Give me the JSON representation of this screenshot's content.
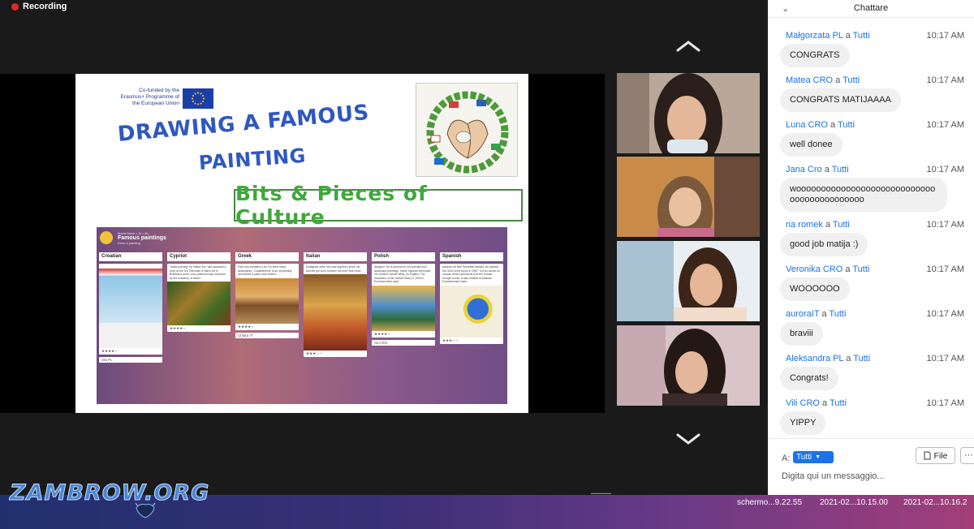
{
  "recording": {
    "label": "Recording",
    "color": "#e02828"
  },
  "slide": {
    "eu_text": "Co-funded by the Erasmus+ Programme of the European Union",
    "title_line1": "DRAWING A FAMOUS",
    "title_line2": "PAINTING",
    "banner": "Bits & Pieces of Culture",
    "padlet": {
      "author": "Marta Batric • 1k • 4h",
      "title": "Famous paintings",
      "subtitle": "Draw a painting",
      "columns": [
        {
          "name": "Croatian",
          "card_text": "",
          "stars": "★★★★☆",
          "footer": "Ola PL"
        },
        {
          "name": "Cypriot",
          "card_text": "Vlatka painting, by Vlatka Vuc, was awarded a prize at the 3rd Triennale of Naive Art in Bratislava and is now posthumously honoured by the academy of others.",
          "stars": "★★★★☆",
          "footer": ""
        },
        {
          "name": "Greek",
          "card_text": "Paris and travelled a lot. He drew many landscapes. 'Coalanthemis' is an oil painting and shows a place near Athens.",
          "stars": "★★★★☆",
          "footer": "Chiara IT"
        },
        {
          "name": "Italian",
          "card_text": "Modigliani when she was eighteen years old and the girl soon became his lover and muse.",
          "stars": "★★★☆☆",
          "footer": ""
        },
        {
          "name": "Polish",
          "card_text": "designer. He is famous for his portraits and landscape paintings. Inside impasto technique. He created 'Zakole Wisly' (in English: The meanders of the Vistula River) in 1904 in Expressionism style.",
          "stars": "★★★★☆",
          "footer": "ria CRO"
        },
        {
          "name": "Spanish",
          "card_text": "abstract art with Surrealist fantasy. He painted the Gold of the Azure in 1967. It is an acrylic on canvas which represents how the human thought works. It was created in Abstract Expressionism style.",
          "stars": "★★★☆☆",
          "footer": ""
        }
      ]
    }
  },
  "chat": {
    "collapse_icon": "chevron-down-icon",
    "title": "Chattare",
    "messages": [
      {
        "sender": "Małgorzata PL",
        "to": "a",
        "recipient": "Tutti",
        "time": "10:17 AM",
        "text": "CONGRATS"
      },
      {
        "sender": "Matea CRO",
        "to": "a",
        "recipient": "Tutti",
        "time": "10:17 AM",
        "text": "CONGRATS MATIJAAAA"
      },
      {
        "sender": "Luna CRO",
        "to": "a",
        "recipient": "Tutti",
        "time": "10:17 AM",
        "text": "well donee"
      },
      {
        "sender": "Jana Cro",
        "to": "a",
        "recipient": "Tutti",
        "time": "10:17 AM",
        "text": "wooooooooooooooooooooooooooooooooooooooooooo"
      },
      {
        "sender": "ria romek",
        "to": "a",
        "recipient": "Tutti",
        "time": "10:17 AM",
        "text": "good job matija :)"
      },
      {
        "sender": "Veronika CRO",
        "to": "a",
        "recipient": "Tutti",
        "time": "10:17 AM",
        "text": "WOOOOOO"
      },
      {
        "sender": "auroraIT",
        "to": "a",
        "recipient": "Tutti",
        "time": "10:17 AM",
        "text": "braviii"
      },
      {
        "sender": "Aleksandra PL",
        "to": "a",
        "recipient": "Tutti",
        "time": "10:17 AM",
        "text": "Congrats!"
      },
      {
        "sender": "Vili CRO",
        "to": "a",
        "recipient": "Tutti",
        "time": "10:17 AM",
        "text": "YIPPY"
      }
    ],
    "to_label": "A:",
    "to_value": "Tutti",
    "file_label": "File",
    "more_label": "···",
    "input_placeholder": "Digita qui un messaggio..."
  },
  "desktop": {
    "watermark": "ZAMBROW.ORG",
    "files": [
      "schermo...9.22.55",
      "2021-02...10.15.00",
      "2021-02...10.16.2"
    ]
  },
  "colors": {
    "accent": "#1a73e8",
    "recording": "#e02828",
    "banner_green": "#3ea93b",
    "title_blue": "#2f58c0"
  }
}
